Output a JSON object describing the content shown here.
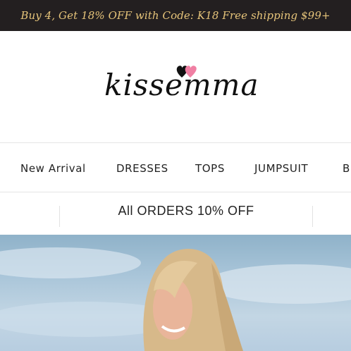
{
  "promo": {
    "text": "Buy 4, Get 18% OFF with Code: K18 Free shipping $99+"
  },
  "brand": {
    "name": "kissemma"
  },
  "nav": {
    "items": [
      {
        "label": "New Arrival"
      },
      {
        "label": "DRESSES"
      },
      {
        "label": "TOPS"
      },
      {
        "label": "JUMPSUIT"
      },
      {
        "label": "B"
      }
    ]
  },
  "announcement": {
    "text": "All ORDERS 10% OFF"
  },
  "colors": {
    "promo_bg": "#231f20",
    "promo_text": "#e6c47a",
    "logo_pink": "#f07fa3",
    "logo_black": "#111111"
  }
}
